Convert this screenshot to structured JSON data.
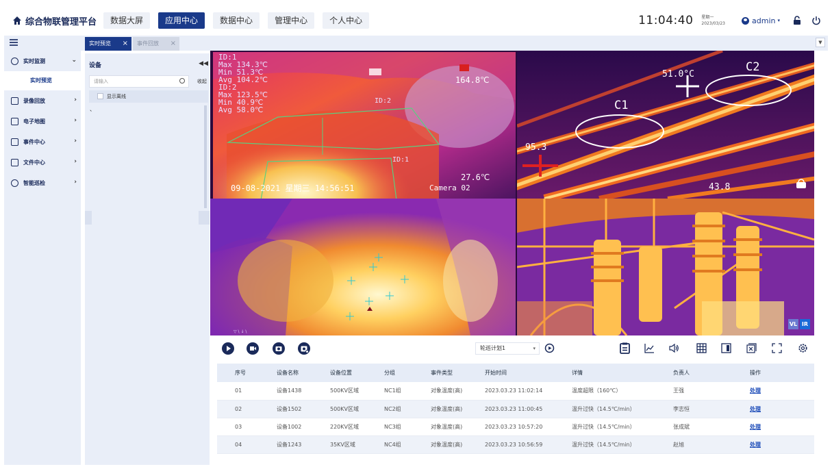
{
  "header": {
    "title": "综合物联管理平台",
    "nav": [
      {
        "label": "数据大屏",
        "active": false
      },
      {
        "label": "应用中心",
        "active": true
      },
      {
        "label": "数据中心",
        "active": false
      },
      {
        "label": "管理中心",
        "active": false
      },
      {
        "label": "个人中心",
        "active": false
      }
    ],
    "time": "11:04:40",
    "weekday": "星期一",
    "date": "2023/03/23",
    "user": "admin"
  },
  "tabs": [
    {
      "label": "实时预览",
      "active": true
    },
    {
      "label": "事件回放",
      "active": false
    }
  ],
  "sidebar": {
    "items": [
      {
        "label": "实时监测",
        "icon": "camera-icon",
        "arrow": "⌄",
        "expanded": true
      },
      {
        "label": "录像回放",
        "icon": "playback-icon",
        "arrow": "›"
      },
      {
        "label": "电子地图",
        "icon": "map-icon",
        "arrow": "›"
      },
      {
        "label": "事件中心",
        "icon": "event-icon",
        "arrow": "›"
      },
      {
        "label": "文件中心",
        "icon": "file-icon",
        "arrow": "›"
      },
      {
        "label": "智能巡检",
        "icon": "inspect-icon",
        "arrow": "›"
      }
    ],
    "sub": "实时预览"
  },
  "device_panel": {
    "title": "设备",
    "search_placeholder": "请输入",
    "fold": "收起",
    "show_offline": "显示离线",
    "tree_item": "、"
  },
  "cameras": {
    "cam1": {
      "readings": [
        "ID:1",
        "Max 134.3℃",
        "Min 51.3℃",
        "Avg 104.2℃",
        "ID:2",
        "Max 123.5℃",
        "Min 40.9℃",
        "Avg 58.0℃"
      ],
      "spot": "164.8℃",
      "id2": "ID:2",
      "id1": "ID:1",
      "low": "27.6℃",
      "osd": "09-08-2021 星期三  14:56:51",
      "name": "Camera 02"
    },
    "cam2": {
      "c1": "C1",
      "c2": "C2",
      "spot": "51.0°C",
      "left": "95.3",
      "bottom": "43.8"
    },
    "cam4": {
      "vl": "VL",
      "ir": "IR"
    }
  },
  "toolbar": {
    "plan": "轮巡计划1"
  },
  "table": {
    "headers": [
      "序号",
      "设备名称",
      "设备位置",
      "分组",
      "事件类型",
      "开始时间",
      "详情",
      "负责人",
      "操作"
    ],
    "rows": [
      [
        "01",
        "设备1438",
        "500KV区域",
        "NC1组",
        "对象温度(高)",
        "2023.03.23  11:02:14",
        "温度超限（160℃）",
        "王强",
        "处理"
      ],
      [
        "02",
        "设备1502",
        "500KV区域",
        "NC2组",
        "对象温度(高)",
        "2023.03.23  11:00:45",
        "温升过快（14.5℃/min）",
        "李志恒",
        "处理"
      ],
      [
        "03",
        "设备1002",
        "220KV区域",
        "NC3组",
        "对象温度(高)",
        "2023.03.23  10:57:20",
        "温升过快（14.5℃/min）",
        "张成斌",
        "处理"
      ],
      [
        "04",
        "设备1243",
        "35KV区域",
        "NC4组",
        "对象温度(高)",
        "2023.03.23  10:56:59",
        "温升过快（14.5℃/min）",
        "赵旭",
        "处理"
      ]
    ]
  },
  "colors": {
    "primary": "#1a3a8a",
    "panel": "#e9eef8",
    "link": "#1a4ab8"
  }
}
